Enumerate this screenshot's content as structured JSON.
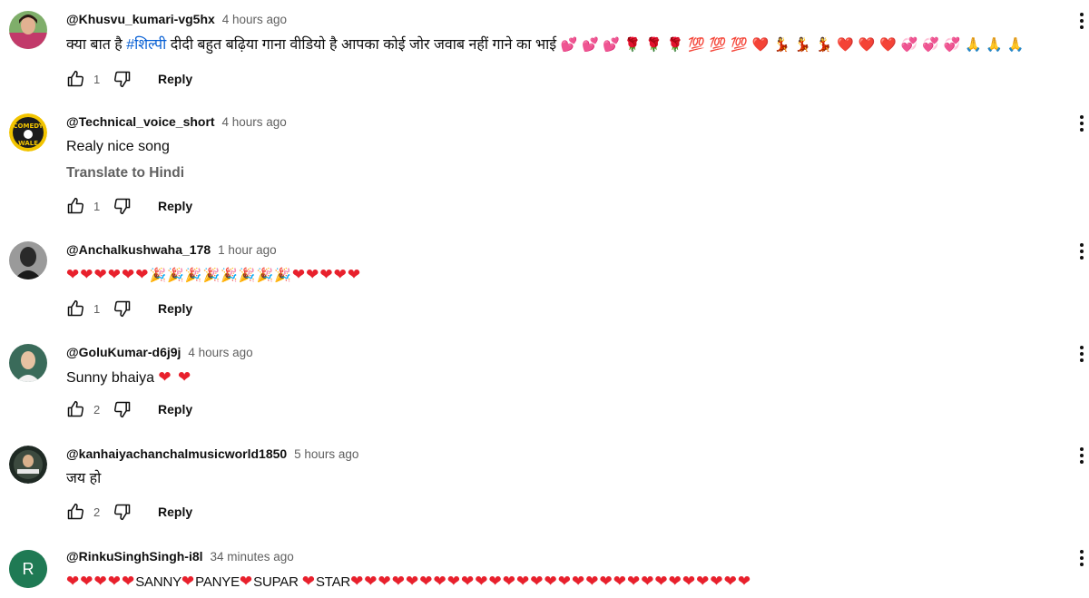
{
  "icons": {
    "like": "thumb-up-outline-icon",
    "dislike": "thumb-down-outline-icon",
    "menu": "more-vert-icon"
  },
  "colors": {
    "link": "#065fd4",
    "meta": "#606060",
    "heart": "#e8202c"
  },
  "comments": [
    {
      "author": "@Khusvu_kumari-vg5hx",
      "time": "4 hours ago",
      "text_before": "क्या बात है ",
      "hashtag": "#शिल्पी",
      "text_after": " दीदी बहुत बढ़िया गाना वीडियो है आपका कोई जोर जवाब नहीं गाने का भाई",
      "emoji_trail": "💕 💕 💕 🌹 🌹 🌹 💯 💯 💯 ❤️ 💃 💃 💃 ❤️ ❤️ ❤️ 💞 💞 💞 🙏 🙏 🙏",
      "likes": "1",
      "reply_label": "Reply"
    },
    {
      "author": "@Technical_voice_short",
      "time": "4 hours ago",
      "text": "Realy nice song",
      "translate_label": "Translate to Hindi",
      "likes": "1",
      "reply_label": "Reply"
    },
    {
      "author": "@Anchalkushwaha_178",
      "time": "1 hour ago",
      "emoji_hearts_1": "❤❤❤❤❤❤",
      "emoji_party": "🎉🎉🎉🎉🎉🎉🎉🎉",
      "emoji_hearts_2": "❤❤❤❤❤",
      "likes": "1",
      "reply_label": "Reply"
    },
    {
      "author": "@GoluKumar-d6j9j",
      "time": "4 hours ago",
      "text": "Sunny bhaiya ",
      "emoji_trail": "❤ ❤",
      "likes": "2",
      "reply_label": "Reply"
    },
    {
      "author": "@kanhaiyachanchalmusicworld1850",
      "time": "5 hours ago",
      "text": "जय हो",
      "likes": "2",
      "reply_label": "Reply"
    },
    {
      "author": "@RinkuSinghSingh-i8l",
      "time": "34 minutes ago",
      "avatar_letter": "R",
      "hearts_lead": "❤❤❤❤❤",
      "w1": "SANNY",
      "w2": "PANYE",
      "w3": "SUPAR",
      "w4": "STAR",
      "hearts_tail": "❤❤❤❤❤❤❤❤❤❤❤❤❤❤❤❤❤❤❤❤❤❤❤❤❤❤❤❤❤"
    }
  ]
}
